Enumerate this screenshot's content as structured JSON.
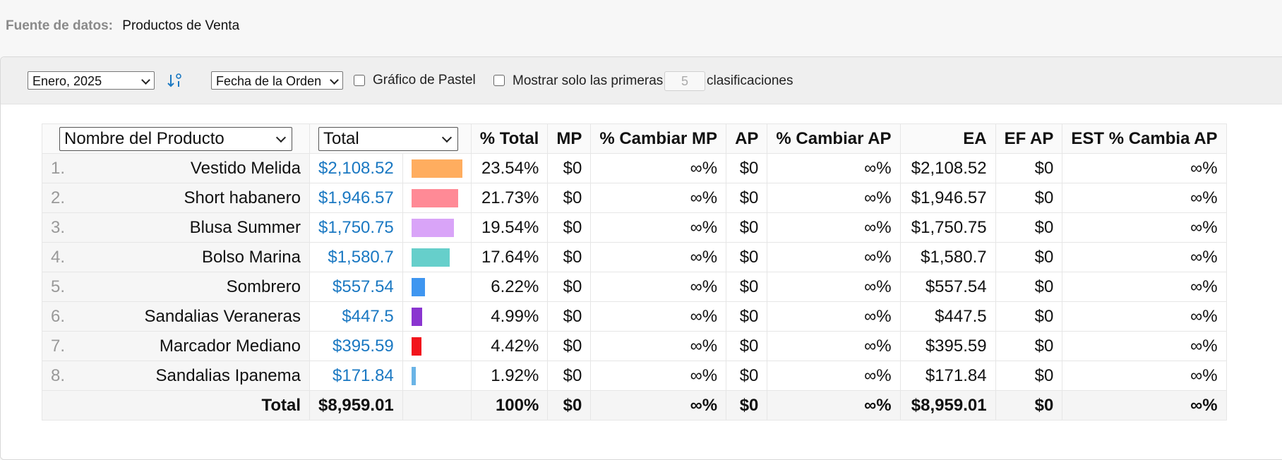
{
  "source": {
    "label": "Fuente de datos:",
    "value": "Productos de Venta"
  },
  "toolbar": {
    "period": "Enero, 2025",
    "date_field": "Fecha de la Orden",
    "pie_label": "Gráfico de Pastel",
    "top_prefix": "Mostrar solo las primeras",
    "top_value": "5",
    "top_suffix": "clasificaciones"
  },
  "table": {
    "group_by": "Nombre del Producto",
    "measure": "Total",
    "headers": [
      "% Total",
      "MP",
      "% Cambiar MP",
      "AP",
      "% Cambiar AP",
      "EA",
      "EF AP",
      "EST % Cambia AP"
    ],
    "rows": [
      {
        "rank": "1.",
        "name": "Vestido Melida",
        "amount": "$2,108.52",
        "share": 23.54,
        "color": "#ffad5f",
        "pct": "23.54%",
        "mp": "$0",
        "cmp": "∞%",
        "ap": "$0",
        "cap": "∞%",
        "ea": "$2,108.52",
        "efap": "$0",
        "est": "∞%"
      },
      {
        "rank": "2.",
        "name": "Short habanero",
        "amount": "$1,946.57",
        "share": 21.73,
        "color": "#ff8a96",
        "pct": "21.73%",
        "mp": "$0",
        "cmp": "∞%",
        "ap": "$0",
        "cap": "∞%",
        "ea": "$1,946.57",
        "efap": "$0",
        "est": "∞%"
      },
      {
        "rank": "3.",
        "name": "Blusa Summer",
        "amount": "$1,750.75",
        "share": 19.54,
        "color": "#d9a4f8",
        "pct": "19.54%",
        "mp": "$0",
        "cmp": "∞%",
        "ap": "$0",
        "cap": "∞%",
        "ea": "$1,750.75",
        "efap": "$0",
        "est": "∞%"
      },
      {
        "rank": "4.",
        "name": "Bolso Marina",
        "amount": "$1,580.7",
        "share": 17.64,
        "color": "#66cfcb",
        "pct": "17.64%",
        "mp": "$0",
        "cmp": "∞%",
        "ap": "$0",
        "cap": "∞%",
        "ea": "$1,580.7",
        "efap": "$0",
        "est": "∞%"
      },
      {
        "rank": "5.",
        "name": "Sombrero",
        "amount": "$557.54",
        "share": 6.22,
        "color": "#3f96f0",
        "pct": "6.22%",
        "mp": "$0",
        "cmp": "∞%",
        "ap": "$0",
        "cap": "∞%",
        "ea": "$557.54",
        "efap": "$0",
        "est": "∞%"
      },
      {
        "rank": "6.",
        "name": "Sandalias Veraneras",
        "amount": "$447.5",
        "share": 4.99,
        "color": "#8a35d0",
        "pct": "4.99%",
        "mp": "$0",
        "cmp": "∞%",
        "ap": "$0",
        "cap": "∞%",
        "ea": "$447.5",
        "efap": "$0",
        "est": "∞%"
      },
      {
        "rank": "7.",
        "name": "Marcador Mediano",
        "amount": "$395.59",
        "share": 4.42,
        "color": "#f2141c",
        "pct": "4.42%",
        "mp": "$0",
        "cmp": "∞%",
        "ap": "$0",
        "cap": "∞%",
        "ea": "$395.59",
        "efap": "$0",
        "est": "∞%"
      },
      {
        "rank": "8.",
        "name": "Sandalias Ipanema",
        "amount": "$171.84",
        "share": 1.92,
        "color": "#6ab4e6",
        "pct": "1.92%",
        "mp": "$0",
        "cmp": "∞%",
        "ap": "$0",
        "cap": "∞%",
        "ea": "$171.84",
        "efap": "$0",
        "est": "∞%"
      }
    ],
    "total": {
      "label": "Total",
      "amount": "$8,959.01",
      "pct": "100%",
      "mp": "$0",
      "cmp": "∞%",
      "ap": "$0",
      "cap": "∞%",
      "ea": "$8,959.01",
      "efap": "$0",
      "est": "∞%"
    }
  }
}
